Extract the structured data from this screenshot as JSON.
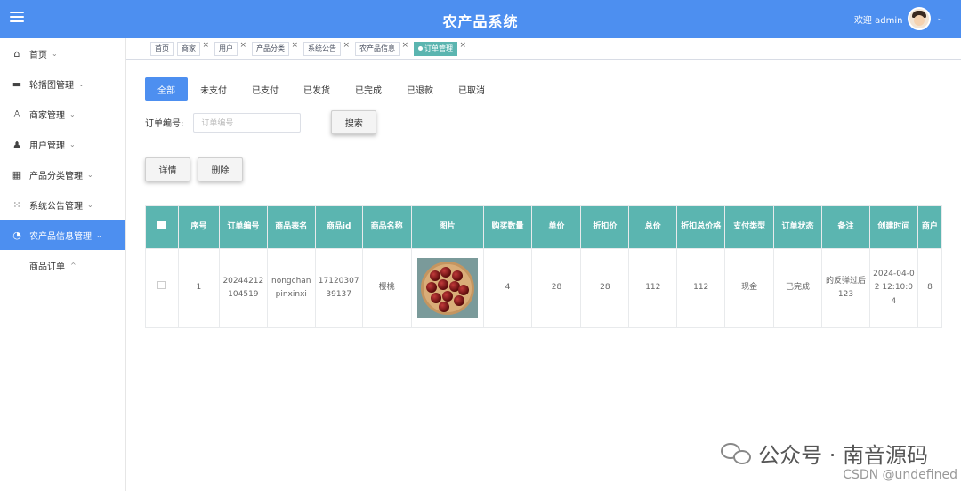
{
  "header": {
    "title": "农产品系统",
    "welcome": "欢迎 admin"
  },
  "sidebar": {
    "items": [
      {
        "label": "首页",
        "icon": "home-icon"
      },
      {
        "label": "轮播图管理",
        "icon": "image-icon"
      },
      {
        "label": "商家管理",
        "icon": "user-outline-icon"
      },
      {
        "label": "用户管理",
        "icon": "user-icon"
      },
      {
        "label": "产品分类管理",
        "icon": "grid-icon"
      },
      {
        "label": "系统公告管理",
        "icon": "apps-icon"
      },
      {
        "label": "农产品信息管理",
        "icon": "gauge-icon"
      }
    ],
    "sub_item": "商品订单"
  },
  "tabs": [
    "首页",
    "商家",
    "用户",
    "产品分类",
    "系统公告",
    "农产品信息",
    "订单管理"
  ],
  "status_tabs": [
    "全部",
    "未支付",
    "已支付",
    "已发货",
    "已完成",
    "已退款",
    "已取消"
  ],
  "search": {
    "label": "订单编号:",
    "placeholder": "订单编号",
    "button": "搜索"
  },
  "actions": {
    "detail": "详情",
    "delete": "删除"
  },
  "table": {
    "headers": [
      "序号",
      "订单编号",
      "商品表名",
      "商品id",
      "商品名称",
      "图片",
      "购买数量",
      "单价",
      "折扣价",
      "总价",
      "折扣总价格",
      "支付类型",
      "订单状态",
      "备注",
      "创建时间",
      "商户"
    ],
    "row": {
      "index": "1",
      "order_no": "20244212104519",
      "table_name": "nongchanpinxinxi",
      "product_id": "1712030739137",
      "product_name": "樱桃",
      "image": "cherry-photo",
      "quantity": "4",
      "unit_price": "28",
      "discount_price": "28",
      "total": "112",
      "discount_total": "112",
      "pay_type": "现金",
      "status": "已完成",
      "remark": "的反弹过后123",
      "created": "2024-04-02 12:10:04",
      "merchant": "8"
    }
  },
  "watermark": {
    "text": "公众号 · 南音源码",
    "csdn": "CSDN @undefined"
  },
  "colors": {
    "primary": "#4d8ff0",
    "table_header": "#5bb5b0"
  }
}
